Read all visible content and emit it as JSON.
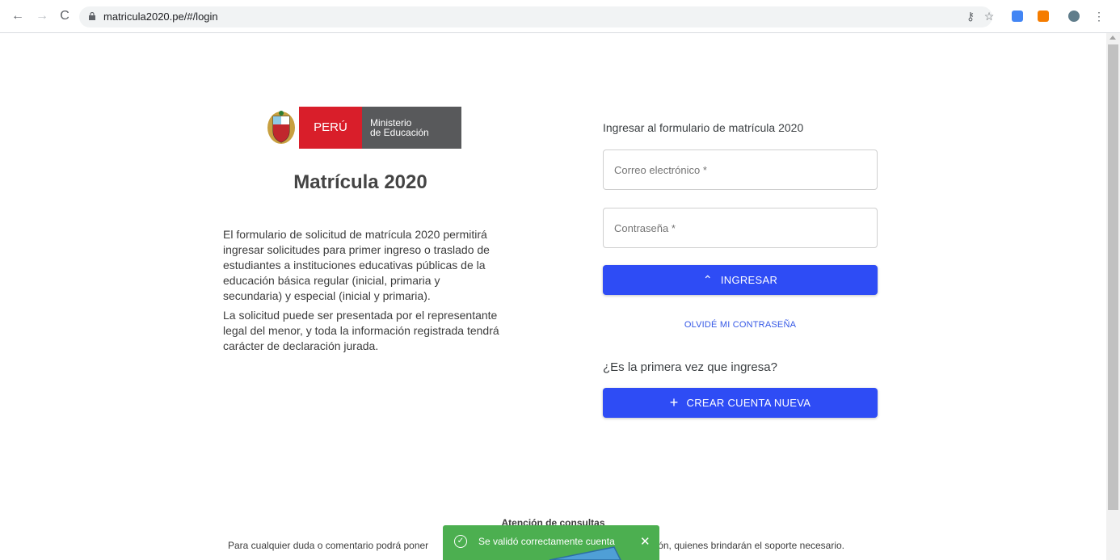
{
  "browser": {
    "url": "matricula2020.pe/#/login",
    "back_icon": "arrow-left-icon",
    "forward_icon": "arrow-right-icon",
    "reload_icon": "reload-icon"
  },
  "logo": {
    "country": "PERÚ",
    "ministry_line1": "Ministerio",
    "ministry_line2": "de Educación"
  },
  "page": {
    "title": "Matrícula 2020",
    "description_1": "El formulario de solicitud de matrícula 2020 permitirá ingresar solicitudes para primer ingreso o traslado de estudiantes a instituciones educativas públicas de la educación básica regular (inicial, primaria y secundaria) y especial (inicial y primaria).",
    "description_2": "La solicitud puede ser presentada por el representante legal del menor, y toda la información registrada tendrá carácter de declaración jurada."
  },
  "login": {
    "heading": "Ingresar al formulario de matrícula 2020",
    "email_placeholder": "Correo electrónico *",
    "password_placeholder": "Contraseña *",
    "submit_label": "INGRESAR",
    "forgot_label": "OLVIDÉ MI CONTRASEÑA",
    "first_time_label": "¿Es la primera vez que ingresa?",
    "create_label": "CREAR CUENTA NUEVA"
  },
  "footer": {
    "title": "Atención de consultas",
    "text_left": "Para cualquier duda o comentario podrá poner",
    "text_right": "icción, quienes brindarán el soporte necesario."
  },
  "toast": {
    "message": "Se validó correctamente cuenta",
    "close": "✕"
  },
  "colors": {
    "primary_button": "#2e4cf5",
    "toast_bg": "#4caf50",
    "peru_red": "#d91e2a",
    "ministry_gray": "#58595b"
  }
}
